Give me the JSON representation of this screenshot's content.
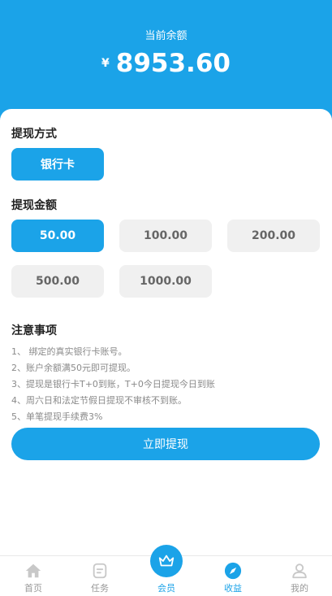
{
  "balance": {
    "label": "当前余额",
    "currency": "¥",
    "amount": "8953.60"
  },
  "method": {
    "title": "提现方式",
    "options": [
      "银行卡"
    ],
    "selected": "银行卡"
  },
  "amount": {
    "title": "提现金额",
    "options": [
      "50.00",
      "100.00",
      "200.00",
      "500.00",
      "1000.00"
    ],
    "selected": "50.00"
  },
  "notes": {
    "title": "注意事项",
    "items": [
      "1、 绑定的真实银行卡账号。",
      "2、账户余额满50元即可提现。",
      "3、提现是银行卡T+0到账，T+0今日提现今日到账",
      "4、周六日和法定节假日提现不审核不到账。",
      "5、单笔提现手续费3%"
    ]
  },
  "submit_label": "立即提现",
  "tabbar": {
    "items": [
      {
        "label": "首页",
        "icon": "home-icon"
      },
      {
        "label": "任务",
        "icon": "task-icon"
      },
      {
        "label": "会员",
        "icon": "crown-icon"
      },
      {
        "label": "收益",
        "icon": "compass-icon"
      },
      {
        "label": "我的",
        "icon": "user-icon"
      }
    ],
    "active": "收益"
  },
  "colors": {
    "accent": "#1ba3e8",
    "inactive_button": "#f0f0f0",
    "note_text": "#8a8a8a"
  }
}
